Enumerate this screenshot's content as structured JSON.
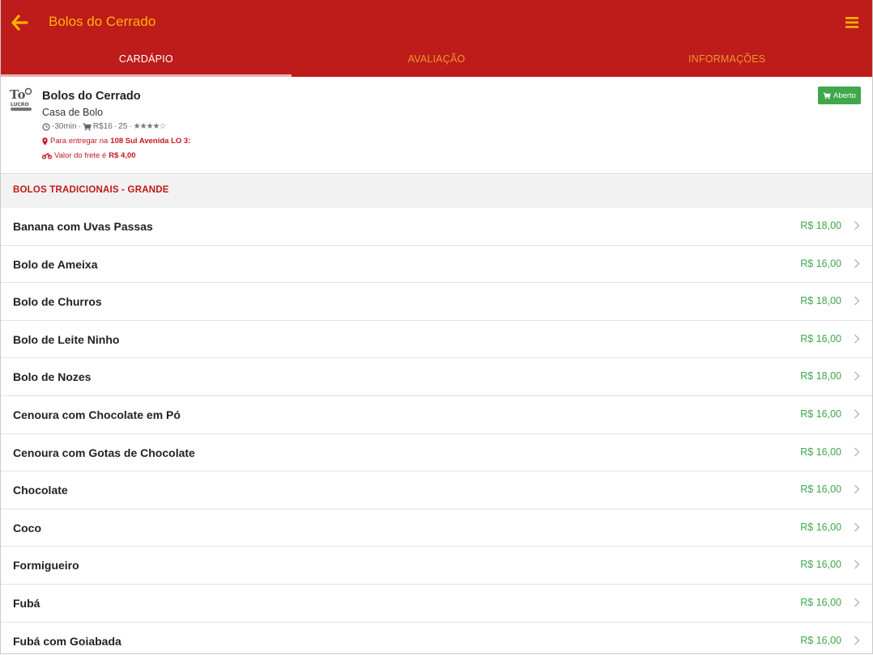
{
  "header": {
    "title": "Bolos do Cerrado",
    "back_icon": "arrow-left-icon",
    "menu_icon": "hamburger-menu-icon",
    "accent_color": "#ffb400",
    "bar_color": "#bd1c1b"
  },
  "tabs": [
    {
      "label": "CARDÁPIO",
      "active": true
    },
    {
      "label": "AVALIAÇÃO",
      "active": false
    },
    {
      "label": "INFORMAÇÕES",
      "active": false
    }
  ],
  "store": {
    "name": "Bolos do Cerrado",
    "category": "Casa de Bolo",
    "delivery_time": "-30min",
    "min_order": "R$16",
    "reviews": "25",
    "rating": 4,
    "rating_max": 5,
    "deliver_prefix": "Para entregar na",
    "deliver_address": "108 Sul Avenida LO 3:",
    "freight_prefix": "Valor do frete é",
    "freight_value": "R$ 4,00",
    "status": "Aberto",
    "status_color": "#3fa84a"
  },
  "section": {
    "title": "BOLOS TRADICIONAIS - GRANDE"
  },
  "items": [
    {
      "name": "Banana com Uvas Passas",
      "price": "R$ 18,00"
    },
    {
      "name": "Bolo de Ameixa",
      "price": "R$ 16,00"
    },
    {
      "name": "Bolo de Churros",
      "price": "R$ 18,00"
    },
    {
      "name": "Bolo de Leite Ninho",
      "price": "R$ 16,00"
    },
    {
      "name": "Bolo de Nozes",
      "price": "R$ 18,00"
    },
    {
      "name": "Cenoura com Chocolate em Pó",
      "price": "R$ 16,00"
    },
    {
      "name": "Cenoura com Gotas de Chocolate",
      "price": "R$ 16,00"
    },
    {
      "name": "Chocolate",
      "price": "R$ 16,00"
    },
    {
      "name": "Coco",
      "price": "R$ 16,00"
    },
    {
      "name": "Formigueiro",
      "price": "R$ 16,00"
    },
    {
      "name": "Fubá",
      "price": "R$ 16,00"
    },
    {
      "name": "Fubá com Goiabada",
      "price": "R$ 16,00"
    }
  ]
}
